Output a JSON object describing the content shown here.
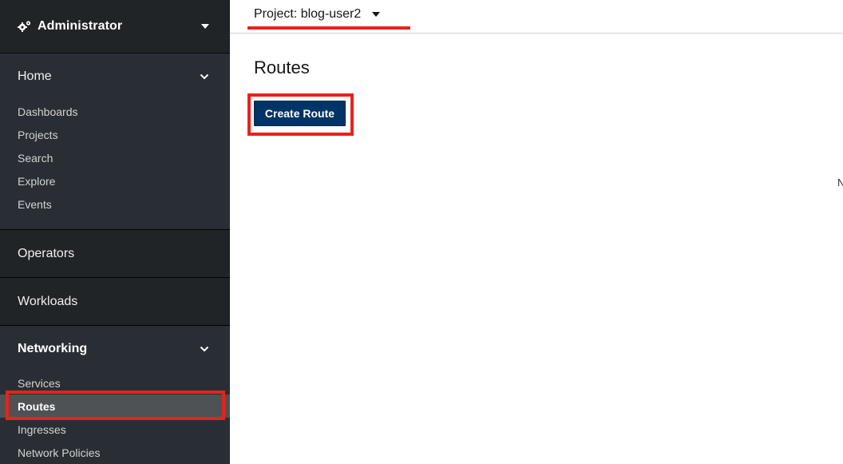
{
  "sidebar": {
    "perspective": "Administrator",
    "sections": [
      {
        "title": "Home",
        "items": [
          "Dashboards",
          "Projects",
          "Search",
          "Explore",
          "Events"
        ]
      },
      {
        "title": "Operators"
      },
      {
        "title": "Workloads"
      },
      {
        "title": "Networking",
        "items": [
          "Services",
          "Routes",
          "Ingresses",
          "Network Policies"
        ]
      }
    ],
    "selected_item": "Routes"
  },
  "topbar": {
    "project_label": "Project: blog-user2"
  },
  "main": {
    "title": "Routes",
    "create_button": "Create Route",
    "cut_off_text": "N"
  },
  "colors": {
    "sidebar_bg": "#212427",
    "primary_button": "#003366",
    "highlight": "#e8221b"
  }
}
